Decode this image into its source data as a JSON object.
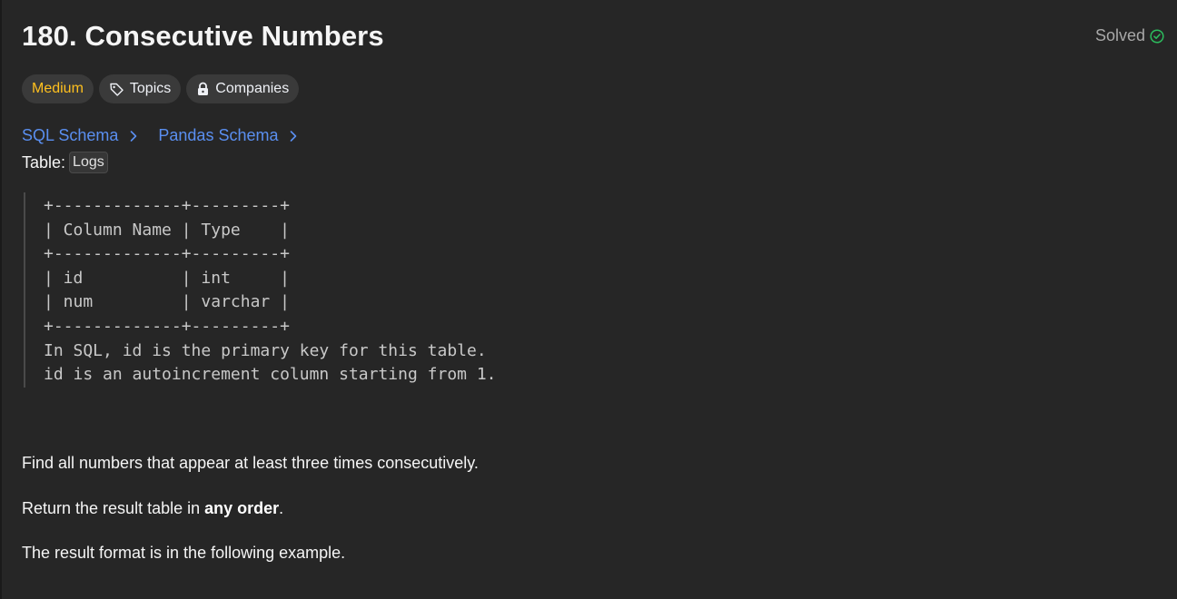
{
  "problem": {
    "title": "180. Consecutive Numbers",
    "status": "Solved"
  },
  "tags": {
    "difficulty": "Medium",
    "topics": "Topics",
    "companies": "Companies"
  },
  "schema_links": {
    "sql": "SQL Schema",
    "pandas": "Pandas Schema"
  },
  "table_label": "Table:",
  "table_name": "Logs",
  "schema_block": "+-------------+---------+\n| Column Name | Type    |\n+-------------+---------+\n| id          | int     |\n| num         | varchar |\n+-------------+---------+\nIn SQL, id is the primary key for this table.\nid is an autoincrement column starting from 1.",
  "description": {
    "p1": "Find all numbers that appear at least three times consecutively.",
    "p2_prefix": "Return the result table in ",
    "p2_bold": "any order",
    "p2_suffix": ".",
    "p3": "The result format is in the following example."
  },
  "colors": {
    "background": "#262626",
    "medium": "#ffc01e",
    "link": "#5a8ff0",
    "solved_check": "#2cbb5d"
  },
  "icons": {
    "solved": "check-circle-icon",
    "topics": "tag-icon",
    "companies": "lock-icon",
    "schema_link": "chevron-right-icon"
  }
}
